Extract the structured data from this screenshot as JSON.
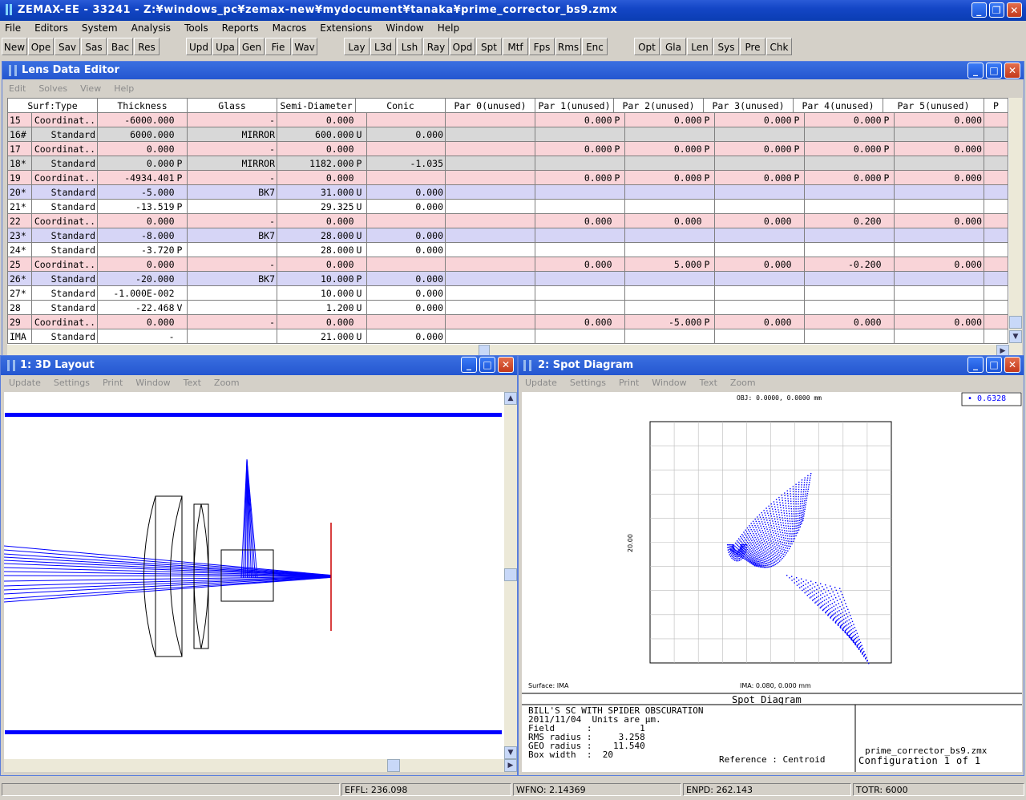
{
  "app": {
    "title": "ZEMAX-EE - 33241 - Z:¥windows_pc¥zemax-new¥mydocument¥tanaka¥prime_corrector_bs9.zmx",
    "menu": [
      "File",
      "Editors",
      "System",
      "Analysis",
      "Tools",
      "Reports",
      "Macros",
      "Extensions",
      "Window",
      "Help"
    ],
    "toolbar": [
      "New",
      "Ope",
      "Sav",
      "Sas",
      "Bac",
      "Res",
      "Upd",
      "Upa",
      "Gen",
      "Fie",
      "Wav",
      "Lay",
      "L3d",
      "Lsh",
      "Ray",
      "Opd",
      "Spt",
      "Mtf",
      "Fps",
      "Rms",
      "Enc",
      "Opt",
      "Gla",
      "Len",
      "Sys",
      "Pre",
      "Chk"
    ]
  },
  "lde": {
    "title": "Lens Data Editor",
    "menu": [
      "Edit",
      "Solves",
      "View",
      "Help"
    ],
    "headers": [
      "Surf:Type",
      "Thickness",
      "Glass",
      "Semi-Diameter",
      "Conic",
      "Par 0(unused)",
      "Par 1(unused)",
      "Par 2(unused)",
      "Par 3(unused)",
      "Par 4(unused)",
      "Par 5(unused)",
      "P"
    ],
    "rows": [
      {
        "s": "15",
        "type": "Coordinat..",
        "th": "-6000.000",
        "ths": "",
        "gl": "-",
        "sd": "0.000",
        "sds": "",
        "co": "",
        "p1": "0.000",
        "p1s": "P",
        "p2": "0.000",
        "p2s": "P",
        "p3": "0.000",
        "p3s": "P",
        "p4": "0.000",
        "p4s": "P",
        "p5": "0.000",
        "c": "pink"
      },
      {
        "s": "16#",
        "type": "Standard",
        "th": "6000.000",
        "ths": "",
        "gl": "MIRROR",
        "sd": "600.000",
        "sds": "U",
        "co": "0.000",
        "p1": "",
        "p1s": "",
        "p2": "",
        "p2s": "",
        "p3": "",
        "p3s": "",
        "p4": "",
        "p4s": "",
        "p5": "",
        "c": "gray"
      },
      {
        "s": "17",
        "type": "Coordinat..",
        "th": "0.000",
        "ths": "",
        "gl": "-",
        "sd": "0.000",
        "sds": "",
        "co": "",
        "p1": "0.000",
        "p1s": "P",
        "p2": "0.000",
        "p2s": "P",
        "p3": "0.000",
        "p3s": "P",
        "p4": "0.000",
        "p4s": "P",
        "p5": "0.000",
        "c": "pink"
      },
      {
        "s": "18*",
        "type": "Standard",
        "th": "0.000",
        "ths": "P",
        "gl": "MIRROR",
        "sd": "1182.000",
        "sds": "P",
        "co": "-1.035",
        "p1": "",
        "p1s": "",
        "p2": "",
        "p2s": "",
        "p3": "",
        "p3s": "",
        "p4": "",
        "p4s": "",
        "p5": "",
        "c": "gray"
      },
      {
        "s": "19",
        "type": "Coordinat..",
        "th": "-4934.401",
        "ths": "P",
        "gl": "-",
        "sd": "0.000",
        "sds": "",
        "co": "",
        "p1": "0.000",
        "p1s": "P",
        "p2": "0.000",
        "p2s": "P",
        "p3": "0.000",
        "p3s": "P",
        "p4": "0.000",
        "p4s": "P",
        "p5": "0.000",
        "c": "pink"
      },
      {
        "s": "20*",
        "type": "Standard",
        "th": "-5.000",
        "ths": "",
        "gl": "BK7",
        "sd": "31.000",
        "sds": "U",
        "co": "0.000",
        "p1": "",
        "p1s": "",
        "p2": "",
        "p2s": "",
        "p3": "",
        "p3s": "",
        "p4": "",
        "p4s": "",
        "p5": "",
        "c": "blue"
      },
      {
        "s": "21*",
        "type": "Standard",
        "th": "-13.519",
        "ths": "P",
        "gl": "",
        "sd": "29.325",
        "sds": "U",
        "co": "0.000",
        "p1": "",
        "p1s": "",
        "p2": "",
        "p2s": "",
        "p3": "",
        "p3s": "",
        "p4": "",
        "p4s": "",
        "p5": "",
        "c": "white"
      },
      {
        "s": "22",
        "type": "Coordinat..",
        "th": "0.000",
        "ths": "",
        "gl": "-",
        "sd": "0.000",
        "sds": "",
        "co": "",
        "p1": "0.000",
        "p1s": "",
        "p2": "0.000",
        "p2s": "",
        "p3": "0.000",
        "p3s": "",
        "p4": "0.200",
        "p4s": "",
        "p5": "0.000",
        "c": "pink"
      },
      {
        "s": "23*",
        "type": "Standard",
        "th": "-8.000",
        "ths": "",
        "gl": "BK7",
        "sd": "28.000",
        "sds": "U",
        "co": "0.000",
        "p1": "",
        "p1s": "",
        "p2": "",
        "p2s": "",
        "p3": "",
        "p3s": "",
        "p4": "",
        "p4s": "",
        "p5": "",
        "c": "blue"
      },
      {
        "s": "24*",
        "type": "Standard",
        "th": "-3.720",
        "ths": "P",
        "gl": "",
        "sd": "28.000",
        "sds": "U",
        "co": "0.000",
        "p1": "",
        "p1s": "",
        "p2": "",
        "p2s": "",
        "p3": "",
        "p3s": "",
        "p4": "",
        "p4s": "",
        "p5": "",
        "c": "white"
      },
      {
        "s": "25",
        "type": "Coordinat..",
        "th": "0.000",
        "ths": "",
        "gl": "-",
        "sd": "0.000",
        "sds": "",
        "co": "",
        "p1": "0.000",
        "p1s": "",
        "p2": "5.000",
        "p2s": "P",
        "p3": "0.000",
        "p3s": "",
        "p4": "-0.200",
        "p4s": "",
        "p5": "0.000",
        "c": "pink"
      },
      {
        "s": "26*",
        "type": "Standard",
        "th": "-20.000",
        "ths": "",
        "gl": "BK7",
        "sd": "10.000",
        "sds": "P",
        "co": "0.000",
        "p1": "",
        "p1s": "",
        "p2": "",
        "p2s": "",
        "p3": "",
        "p3s": "",
        "p4": "",
        "p4s": "",
        "p5": "",
        "c": "blue"
      },
      {
        "s": "27*",
        "type": "Standard",
        "th": "-1.000E-002",
        "ths": "",
        "gl": "",
        "sd": "10.000",
        "sds": "U",
        "co": "0.000",
        "p1": "",
        "p1s": "",
        "p2": "",
        "p2s": "",
        "p3": "",
        "p3s": "",
        "p4": "",
        "p4s": "",
        "p5": "",
        "c": "white"
      },
      {
        "s": "28",
        "type": "Standard",
        "th": "-22.468",
        "ths": "V",
        "gl": "",
        "sd": "1.200",
        "sds": "U",
        "co": "0.000",
        "p1": "",
        "p1s": "",
        "p2": "",
        "p2s": "",
        "p3": "",
        "p3s": "",
        "p4": "",
        "p4s": "",
        "p5": "",
        "c": "white"
      },
      {
        "s": "29",
        "type": "Coordinat..",
        "th": "0.000",
        "ths": "",
        "gl": "-",
        "sd": "0.000",
        "sds": "",
        "co": "",
        "p1": "0.000",
        "p1s": "",
        "p2": "-5.000",
        "p2s": "P",
        "p3": "0.000",
        "p3s": "",
        "p4": "0.000",
        "p4s": "",
        "p5": "0.000",
        "c": "pink"
      },
      {
        "s": "IMA",
        "type": "Standard",
        "th": "-",
        "ths": "",
        "gl": "",
        "sd": "21.000",
        "sds": "U",
        "co": "0.000",
        "p1": "",
        "p1s": "",
        "p2": "",
        "p2s": "",
        "p3": "",
        "p3s": "",
        "p4": "",
        "p4s": "",
        "p5": "",
        "c": "white"
      }
    ]
  },
  "layout": {
    "title": "1: 3D Layout",
    "menu": [
      "Update",
      "Settings",
      "Print",
      "Window",
      "Text",
      "Zoom"
    ]
  },
  "spot": {
    "title": "2: Spot Diagram",
    "menu": [
      "Update",
      "Settings",
      "Print",
      "Window",
      "Text",
      "Zoom"
    ],
    "legend_value": "0.6328",
    "obj_label": "OBJ: 0.0000, 0.0000 mm",
    "scale_label": "20.00",
    "surface_label": "Surface: IMA",
    "ima_label": "IMA: 0.080, 0.000 mm",
    "panel_title": "Spot Diagram",
    "info_lines": [
      "BILL'S SC WITH SPIDER OBSCURATION",
      "2011/11/04  Units are µm.",
      "Field      :         1",
      "RMS radius :     3.258",
      "GEO radius :    11.540",
      "Box width  :  20"
    ],
    "reference": "Reference  : Centroid",
    "filename": "prime_corrector_bs9.zmx",
    "configuration": "Configuration 1 of 1"
  },
  "status": {
    "effl": "EFFL: 236.098",
    "wfno": "WFNO: 2.14369",
    "enpd": "ENPD: 262.143",
    "totr": "TOTR: 6000"
  },
  "colors": {
    "ray": "#0000ff",
    "image_plane": "#cc0000",
    "titlebar": "#1446c6"
  }
}
